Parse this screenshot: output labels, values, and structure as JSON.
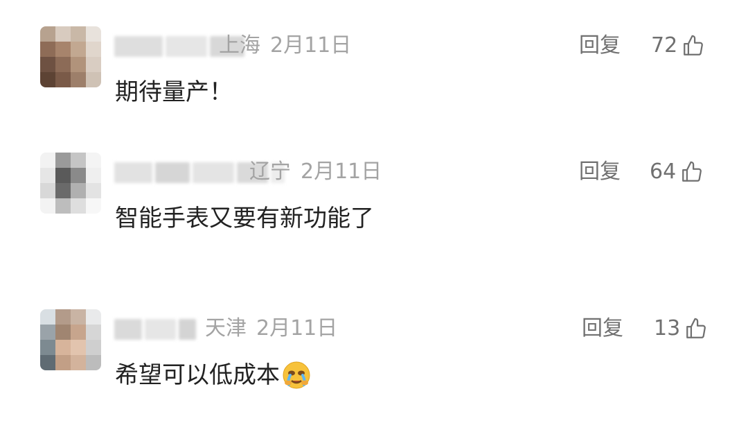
{
  "comments": [
    {
      "location": "上海",
      "date": "2月11日",
      "reply_label": "回复",
      "likes": "72",
      "text": "期待量产！",
      "avatar_colors": [
        "#b7a28f",
        "#d8cbbf",
        "#c9b8a7",
        "#e8e2dc",
        "#8e6c57",
        "#a7846c",
        "#c2a891",
        "#e0d6cc",
        "#6e5142",
        "#8c6b57",
        "#b1937b",
        "#d9cdc2",
        "#5d4334",
        "#7a5a48",
        "#9d7f6a",
        "#cfc2b5"
      ]
    },
    {
      "location": "辽宁",
      "date": "2月11日",
      "reply_label": "回复",
      "likes": "64",
      "text": "智能手表又要有新功能了",
      "avatar_colors": [
        "#f2f2f2",
        "#9a9a9a",
        "#c5c5c5",
        "#f4f4f4",
        "#e6e6e6",
        "#5a5a5a",
        "#8a8a8a",
        "#efefef",
        "#d8d8d8",
        "#6a6a6a",
        "#b0b0b0",
        "#e3e3e3",
        "#f3f3f3",
        "#bdbdbd",
        "#dedede",
        "#f7f7f7"
      ]
    },
    {
      "location": "天津",
      "date": "2月11日",
      "reply_label": "回复",
      "likes": "13",
      "text": "希望可以低成本",
      "avatar_colors": [
        "#d9dfe3",
        "#b39b8a",
        "#c9b4a4",
        "#e9eaeb",
        "#9aa3a9",
        "#a08571",
        "#c7a58d",
        "#d6d6d6",
        "#7d8a91",
        "#d7b49b",
        "#e2c4ae",
        "#cfcfcf",
        "#5f6b73",
        "#c29f86",
        "#d3b39c",
        "#bcbcbc"
      ]
    }
  ],
  "name_blur_colors": [
    "#dcdcdc",
    "#e8e8e8",
    "#cfcfcf"
  ],
  "emoji_icon": "crying-face-icon",
  "like_icon": "thumbs-up-icon"
}
